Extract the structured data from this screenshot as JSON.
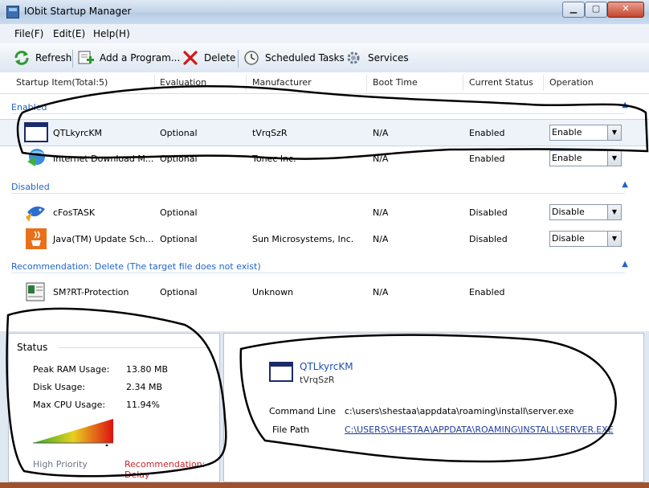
{
  "window": {
    "title": "IObit Startup Manager"
  },
  "menu": [
    "File(F)",
    "Edit(E)",
    "Help(H)"
  ],
  "toolbar": {
    "refresh": "Refresh",
    "add_program": "Add a Program...",
    "delete": "Delete",
    "scheduled_tasks": "Scheduled Tasks",
    "services": "Services"
  },
  "columns": [
    "Startup Item(Total:5)",
    "Evaluation",
    "Manufacturer",
    "Boot Time",
    "Current Status",
    "Operation"
  ],
  "groups": [
    {
      "label": "Enabled",
      "rows": [
        {
          "name": "QTLkyrcKM",
          "evaluation": "Optional",
          "manufacturer": "tVrqSzR",
          "boot_time": "N/A",
          "status": "Enabled",
          "operation": "Enable",
          "icon": "window-app-icon"
        },
        {
          "name": "Internet Download M...",
          "evaluation": "Optional",
          "manufacturer": "Tonec Inc.",
          "boot_time": "N/A",
          "status": "Enabled",
          "operation": "Enable",
          "icon": "idm-globe-icon"
        }
      ]
    },
    {
      "label": "Disabled",
      "rows": [
        {
          "name": "cFosTASK",
          "evaluation": "Optional",
          "manufacturer": "",
          "boot_time": "N/A",
          "status": "Disabled",
          "operation": "Disable",
          "icon": "cfos-fish-icon"
        },
        {
          "name": "Java(TM) Update Sch...",
          "evaluation": "Optional",
          "manufacturer": "Sun Microsystems, Inc.",
          "boot_time": "N/A",
          "status": "Disabled",
          "operation": "Disable",
          "icon": "java-cup-icon"
        }
      ]
    },
    {
      "label": "Recommendation: Delete  (The target file does not exist)",
      "rows": [
        {
          "name": "SM?RT-Protection",
          "evaluation": "Optional",
          "manufacturer": "Unknown",
          "boot_time": "N/A",
          "status": "Enabled",
          "operation": "",
          "icon": "document-app-icon"
        }
      ]
    }
  ],
  "status": {
    "title": "Status",
    "peak_ram_label": "Peak RAM Usage:",
    "peak_ram_value": "13.80 MB",
    "disk_label": "Disk Usage:",
    "disk_value": "2.34 MB",
    "cpu_label": "Max CPU Usage:",
    "cpu_value": "11.94%",
    "high_priority": "High Priority",
    "recommendation": "Recommendation: Delay",
    "colors": {
      "low": "#22aa22",
      "high": "#dd1111"
    }
  },
  "detail": {
    "name": "QTLkyrcKM",
    "manufacturer": "tVrqSzR",
    "command_line_label": "Command Line",
    "command_line": "c:\\users\\shestaa\\appdata\\roaming\\install\\server.exe",
    "file_path_label": "File Path",
    "file_path": "C:\\USERS\\SHESTAA\\APPDATA\\ROAMING\\INSTALL\\SERVER.EXE"
  }
}
